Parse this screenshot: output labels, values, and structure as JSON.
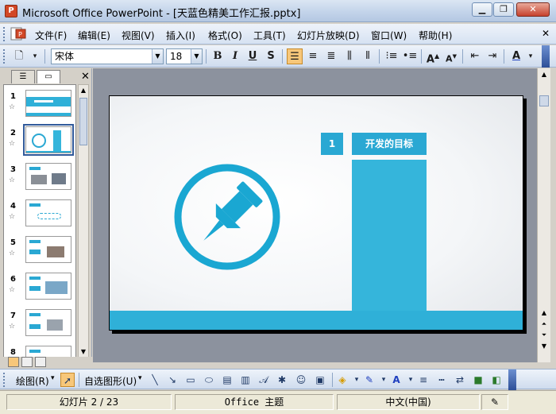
{
  "window": {
    "title": "Microsoft Office PowerPoint - [天蓝色精美工作汇报.pptx]",
    "minimize_label": "▁",
    "restore_label": "❐",
    "close_label": "✕"
  },
  "menu": {
    "items": [
      "文件(F)",
      "编辑(E)",
      "视图(V)",
      "插入(I)",
      "格式(O)",
      "工具(T)",
      "幻灯片放映(D)",
      "窗口(W)",
      "帮助(H)"
    ]
  },
  "toolbar": {
    "font_name": "宋体",
    "font_size": "18",
    "bold_label": "B",
    "italic_label": "I",
    "underline_label": "U",
    "shadow_label": "S"
  },
  "pane": {
    "tab_outline_icon": "outline-icon",
    "tab_slides_icon": "slides-icon",
    "close_label": "✕",
    "slides": [
      {
        "number": "1"
      },
      {
        "number": "2"
      },
      {
        "number": "3"
      },
      {
        "number": "4"
      },
      {
        "number": "5"
      },
      {
        "number": "6"
      },
      {
        "number": "7"
      },
      {
        "number": "8"
      }
    ],
    "selected_slide": 2
  },
  "slide": {
    "number_label": "1",
    "title": "开发的目标",
    "accent_color": "#2aa8d3",
    "icon": "pushpin-icon"
  },
  "drawbar": {
    "draw_menu": "绘图(R)",
    "autoshapes_menu": "自选图形(U)"
  },
  "status": {
    "slide_position": "幻灯片 2 / 23",
    "theme": "Office 主题",
    "language": "中文(中国)"
  }
}
